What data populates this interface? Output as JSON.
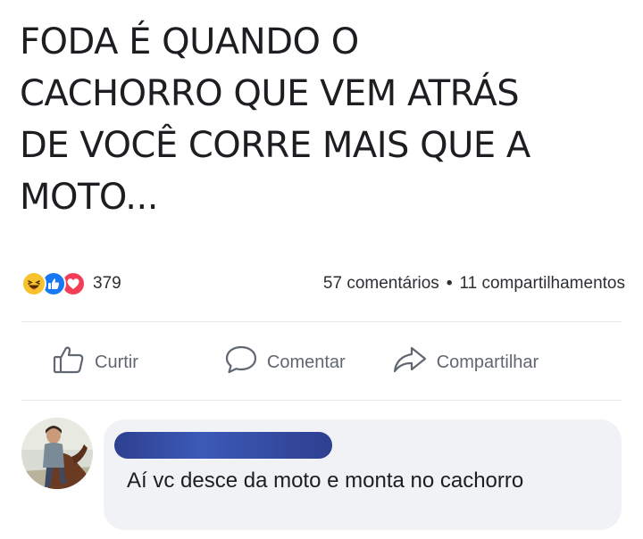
{
  "post": {
    "text": "FODA É QUANDO O\nCACHORRO QUE VEM ATRÁS\nDE VOCÊ CORRE MAIS QUE A\nMOTO..."
  },
  "reactions": {
    "icons": [
      "haha-icon",
      "like-icon",
      "love-icon"
    ],
    "count": "379",
    "comments": "57 comentários",
    "separator": "•",
    "shares": "11 compartilhamentos"
  },
  "actions": {
    "like_label": "Curtir",
    "comment_label": "Comentar",
    "share_label": "Compartilhar"
  },
  "comment": {
    "text": "Aí vc desce da moto e monta no cachorro"
  },
  "colors": {
    "like_blue": "#1877f2",
    "love_red": "#f33e58",
    "haha_yellow": "#f7c22e",
    "redaction_blue": "#2d3f90",
    "bubble_gray": "#f0f2f5",
    "action_gray": "#606770"
  }
}
